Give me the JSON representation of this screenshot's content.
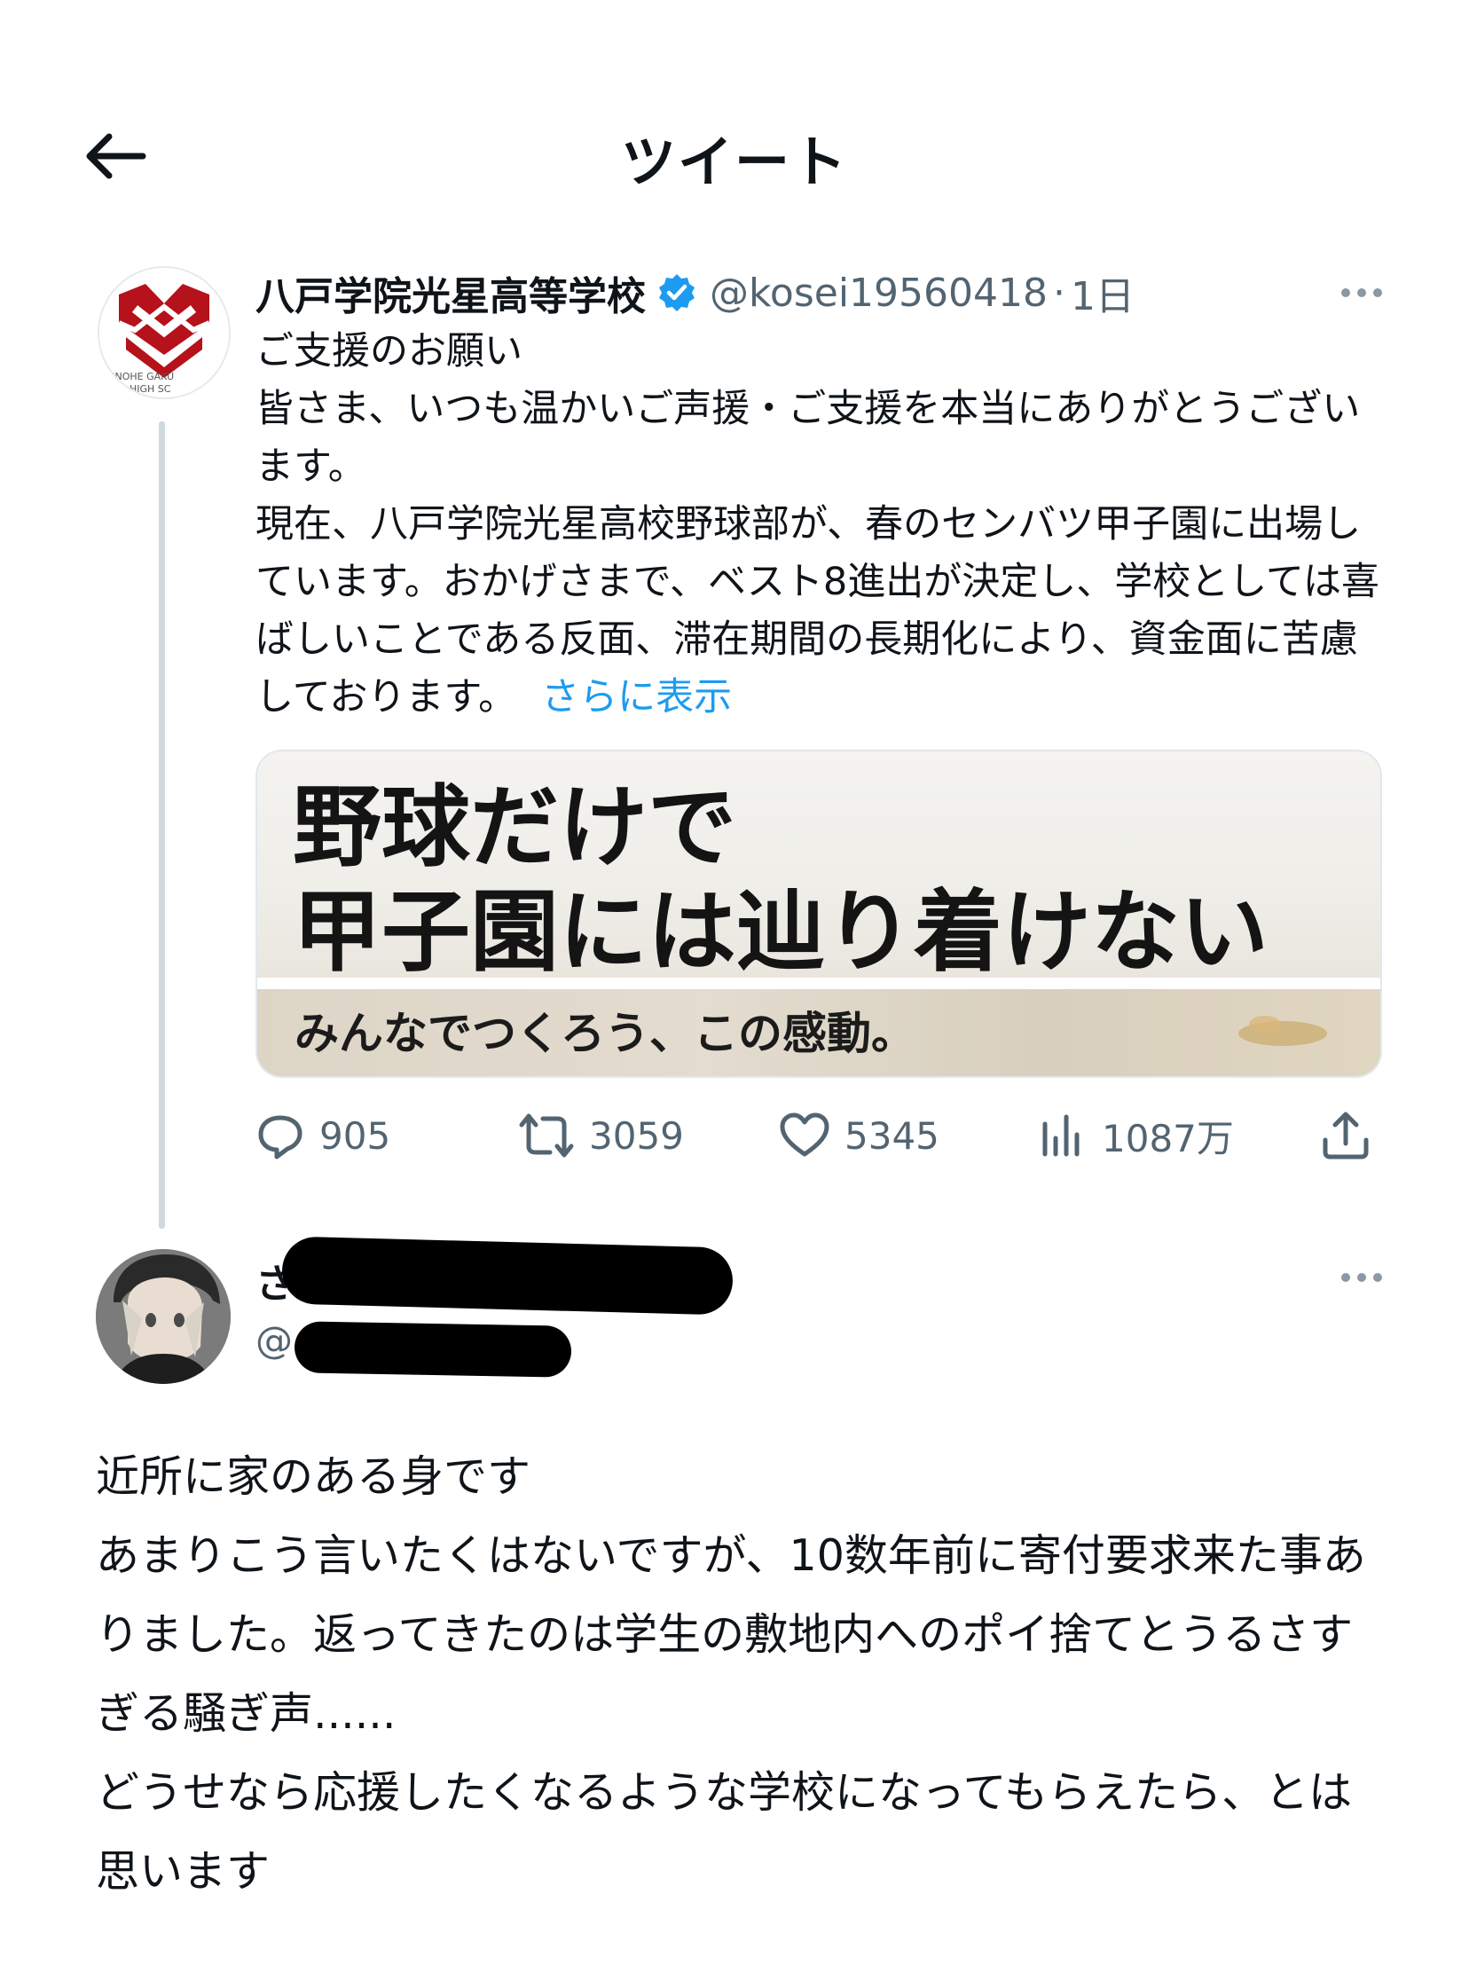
{
  "header": {
    "title": "ツイート"
  },
  "original_tweet": {
    "display_name": "八戸学院光星高等学校",
    "handle": "@kosei19560418",
    "separator": "·",
    "time": "1日",
    "verified_icon": "verified-badge-icon",
    "avatar_caption_1": "HINOHE GAKU",
    "avatar_caption_2": "HIGH SC",
    "body": "ご支援のお願い\n皆さま、いつも温かいご声援・ご支援を本当にありがとうございます。\n現在、八戸学院光星高校野球部が、春のセンバツ甲子園に出場しています。おかげさまで、ベスト8進出が決定し、学校としては喜ばしいことである反面、滞在期間の長期化により、資金面に苦慮しております。",
    "show_more": "さらに表示",
    "media": {
      "headline_1": "野球だけで",
      "headline_2": "甲子園には辿り着けない",
      "subline": "みんなでつくろう、この感動。"
    },
    "stats": {
      "replies": "905",
      "retweets": "3059",
      "likes": "5345",
      "views": "1087万"
    }
  },
  "reply": {
    "display_name_visible": "さ",
    "handle_visible": "@",
    "body": "近所に家のある身です\nあまりこう言いたくはないですが、10数年前に寄付要求来た事ありました。返ってきたのは学生の敷地内へのポイ捨てとうるさすぎる騒ぎ声......\nどうせなら応援したくなるような学校になってもらえたら、とは思います"
  },
  "colors": {
    "accent": "#1d9bf0",
    "muted": "#536471",
    "text": "#0f1419",
    "thread_line": "#cfd9de",
    "school_red": "#b5121b"
  }
}
